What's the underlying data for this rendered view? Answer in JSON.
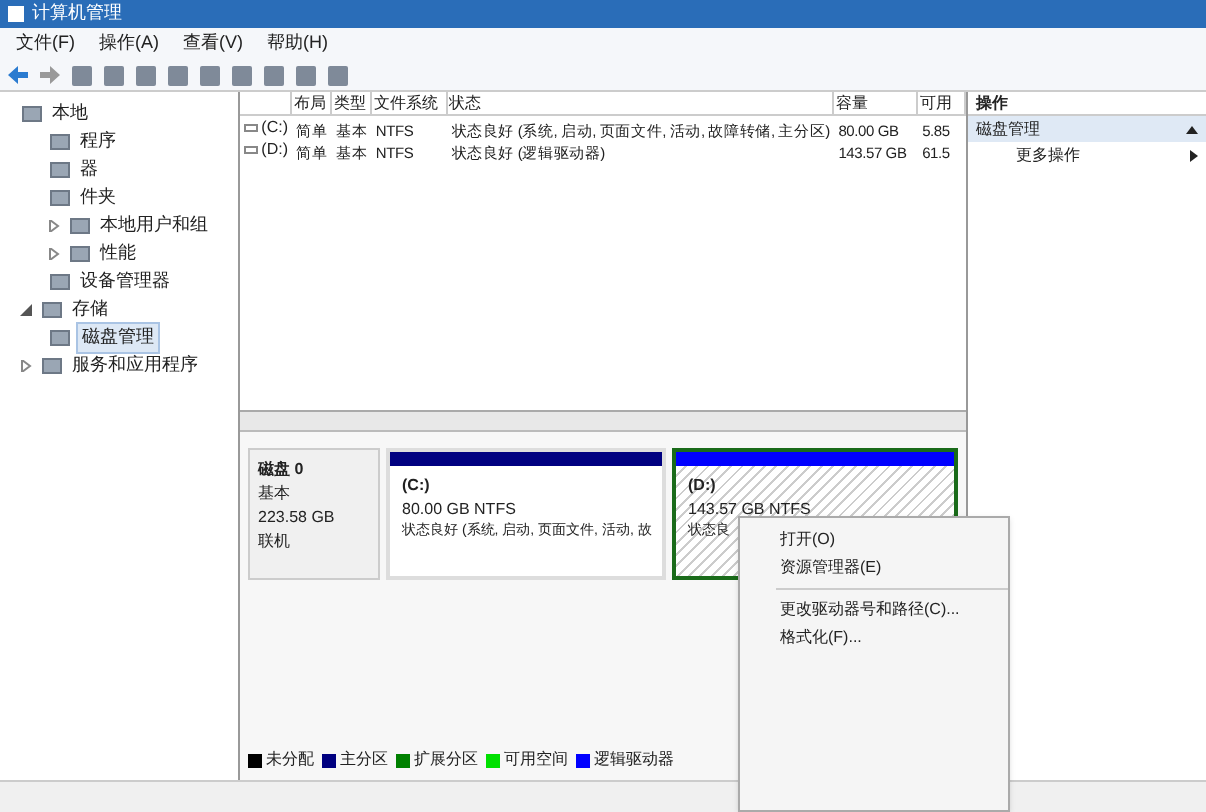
{
  "window": {
    "title": "计算机管理"
  },
  "menu_bar": [
    "文件(F)",
    "操作(A)",
    "查看(V)",
    "帮助(H)"
  ],
  "tree": [
    {
      "label": "本地",
      "children": [
        {
          "label": "程序"
        },
        {
          "label": "器"
        },
        {
          "label": "件夹"
        },
        {
          "label": "本地用户和组",
          "expanded": false
        },
        {
          "label": "性能",
          "expanded": false
        },
        {
          "label": "设备管理器"
        }
      ]
    },
    {
      "label": "存储",
      "expanded": true,
      "children": [
        {
          "label": "磁盘管理",
          "selected": true
        }
      ]
    },
    {
      "label": "服务和应用程序",
      "expanded": false
    }
  ],
  "volumes": {
    "columns": [
      "布局",
      "类型",
      "文件系统",
      "状态",
      "容量",
      "可用"
    ],
    "rows": [
      {
        "volume": "(C:)",
        "cells": [
          "简单",
          "基本",
          "NTFS",
          "状态良好 (系统, 启动, 页面文件, 活动, 故障转储, 主分区)",
          "80.00 GB",
          "5.85"
        ]
      },
      {
        "volume": "(D:)",
        "cells": [
          "简单",
          "基本",
          "NTFS",
          "状态良好 (逻辑驱动器)",
          "143.57 GB",
          "61.5"
        ]
      }
    ]
  },
  "disk": {
    "name": "磁盘 0",
    "type": "基本",
    "size": "223.58 GB",
    "status": "联机",
    "partitions": [
      {
        "label": "(C:)",
        "size": "80.00 GB NTFS",
        "status": "状态良好 (系统, 启动, 页面文件, 活动, 故",
        "color": "#000080",
        "selected": false
      },
      {
        "label": "(D:)",
        "size": "143.57 GB NTFS",
        "status": "状态良",
        "color": "#0000ff",
        "selected": true
      }
    ]
  },
  "legend": [
    {
      "label": "未分配",
      "color": "#000000"
    },
    {
      "label": "主分区",
      "color": "#000080"
    },
    {
      "label": "扩展分区",
      "color": "#008000"
    },
    {
      "label": "可用空间",
      "color": "#00e000"
    },
    {
      "label": "逻辑驱动器",
      "color": "#0000ff"
    }
  ],
  "actions": {
    "title": "操作",
    "section": "磁盘管理",
    "items": [
      "更多操作"
    ]
  },
  "context_menu": [
    [
      "打开(O)",
      "资源管理器(E)"
    ],
    [
      "更改驱动器号和路径(C)...",
      "格式化(F)..."
    ]
  ]
}
